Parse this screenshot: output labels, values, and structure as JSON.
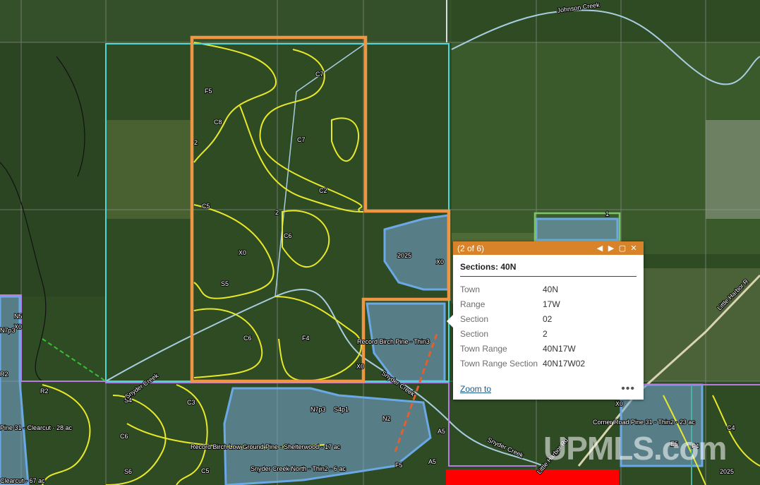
{
  "map": {
    "stand_labels": [
      "F5",
      "C7",
      "C8",
      "C7",
      "C2",
      "C5",
      "C6",
      "X0",
      "S5",
      "C6",
      "F4",
      "X0",
      "2025",
      "X0",
      "N5",
      "X0",
      "N7p3",
      "R2",
      "R2",
      "S4",
      "C3",
      "C6",
      "S6",
      "C5",
      "N7p3",
      "S4p1",
      "N2",
      "A5",
      "F5",
      "A5",
      "X0",
      "E5",
      "F4",
      "C4",
      "2025"
    ],
    "stand_annotations": [
      "Record Birch Pine - Thin3",
      "Record Birch Low Ground Pine - Shelterwood - 17 ac",
      "Snyder Creek North - Thin2 - 6 ac",
      "Corner Road Pine 31 - Thin2 - 23 ac",
      "Pine 31 - Clearcut - 28 ac",
      "Clearcut - 67 ac"
    ],
    "road_labels": [
      "Johnson Creek",
      "Snyder Creek",
      "Snyder Creek",
      "Snyder Creek",
      "Little Harbor Rd",
      "Little Harbor R"
    ],
    "section_numbers": [
      "2",
      "2",
      "1"
    ],
    "colors": {
      "selected_parcel": "#ef9645",
      "section_outline": "#4fd8d8",
      "stand_boundary": "#e8e82a",
      "harvest_area": "#6aa9e6",
      "parcel_purple": "#b77de0",
      "parcel_green": "#7cc46a",
      "red_parcel": "#ff0000"
    }
  },
  "popup": {
    "counter": "(2 of 6)",
    "prev_icon": "previous-icon",
    "next_icon": "next-icon",
    "dock_icon": "dock-icon",
    "close_icon": "close-icon",
    "title": "Sections: 40N",
    "attributes": [
      {
        "key": "Town",
        "value": "40N"
      },
      {
        "key": "Range",
        "value": "17W"
      },
      {
        "key": "Section",
        "value": "02"
      },
      {
        "key": "Section",
        "value": "2"
      },
      {
        "key": "Town Range",
        "value": "40N17W"
      },
      {
        "key": "Town Range Section",
        "value": "40N17W02"
      }
    ],
    "zoom_label": "Zoom to",
    "more_label": "•••"
  },
  "watermark": "UPMLS.com"
}
